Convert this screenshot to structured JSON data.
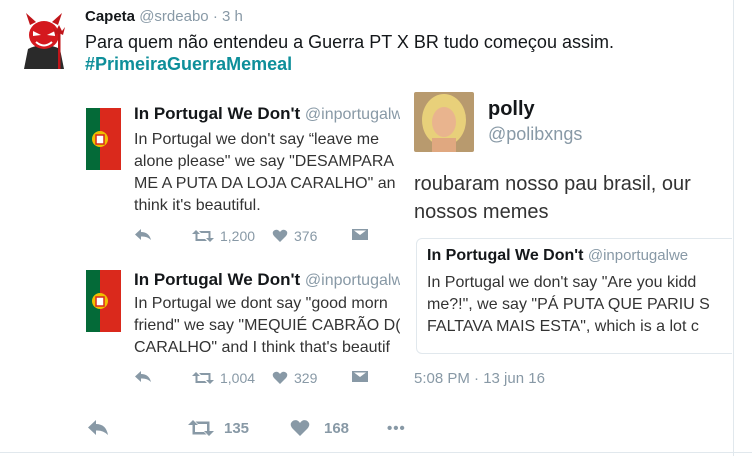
{
  "tweet": {
    "display_name": "Capeta",
    "handle": "@srdeabo",
    "time": "· 3 h",
    "text": "Para quem não entendeu a Guerra PT X BR tudo começou assim.",
    "hashtag": "#PrimeiraGuerraMemeal",
    "retweets": "135",
    "likes": "168",
    "more": "•••"
  },
  "embedded": {
    "ipw1": {
      "name": "In Portugal We Don't",
      "handle": "@inportugalwe",
      "lines": [
        "In Portugal we don't say “leave me",
        "alone please\" we say \"DESAMPARA",
        "ME A PUTA DA LOJA CARALHO\" an",
        "think it's beautiful."
      ],
      "retweets": "1,200",
      "likes": "376"
    },
    "ipw2": {
      "name": "In Portugal We Don't",
      "handle": "@inportugalwe",
      "lines": [
        "In Portugal we dont say \"good morn",
        "friend\" we say \"MEQUIÉ CABRÃO D(",
        "CARALHO\" and I think that's beautif"
      ],
      "retweets": "1,004",
      "likes": "329"
    },
    "polly": {
      "name": "polly",
      "handle": "@polibxngs",
      "lines": [
        "roubaram nosso pau brasil, our",
        "nossos memes"
      ],
      "quote_name": "In Portugal We Don't",
      "quote_handle": "@inportugalwe",
      "quote_lines": [
        "In Portugal we don't say \"Are you kidd",
        "me?!\", we say \"PÁ PUTA QUE PARIU S",
        "FALTAVA MAIS ESTA\", which is a lot c"
      ],
      "timestamp": "5:08 PM · 13 jun 16"
    }
  },
  "colors": {
    "text": "#14171a",
    "secondary": "#8899a6",
    "hashtag": "#0e8f9a",
    "flag_green": "#046a38",
    "flag_red": "#da291c"
  },
  "icons": [
    "devil-avatar",
    "reply-icon",
    "retweet-icon",
    "heart-icon",
    "dm-icon",
    "more-icon",
    "portugal-flag"
  ]
}
